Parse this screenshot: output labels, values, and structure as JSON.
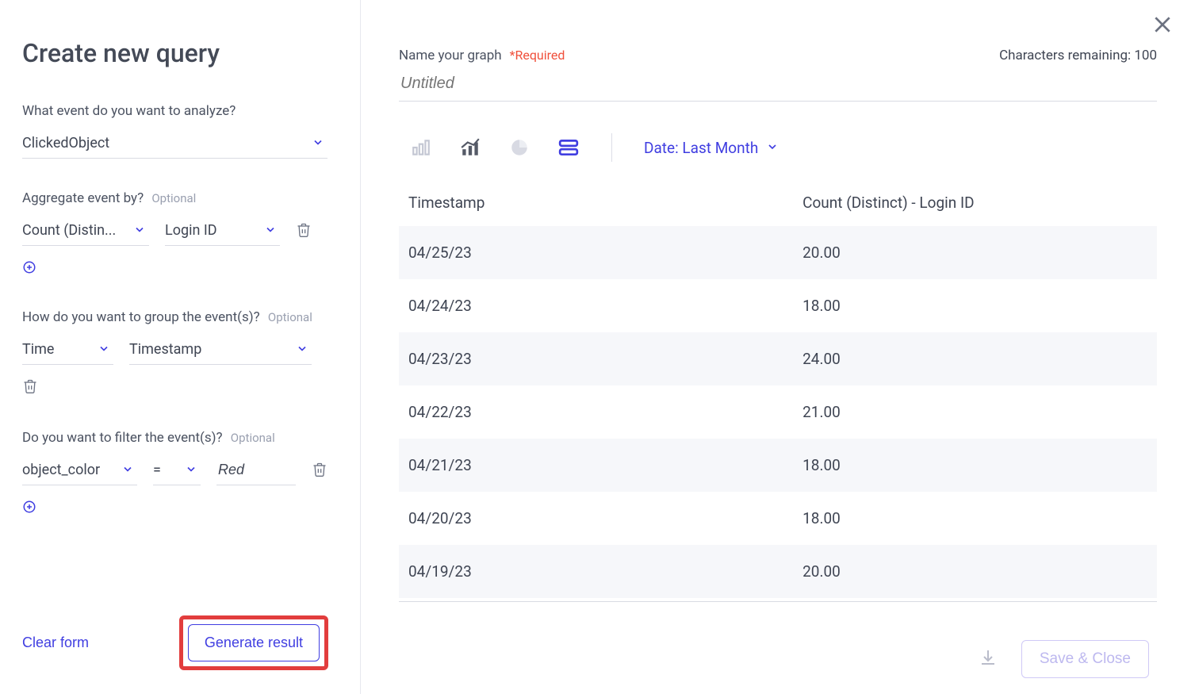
{
  "title": "Create new query",
  "sidebar": {
    "event_label": "What event do you want to analyze?",
    "event_value": "ClickedObject",
    "aggregate_label": "Aggregate event by?",
    "optional": "Optional",
    "aggregate_func": "Count (Distin...",
    "aggregate_field": "Login ID",
    "group_label": "How do you want to group the event(s)?",
    "group_by_1": "Time",
    "group_by_2": "Timestamp",
    "filter_label": "Do you want to filter the event(s)?",
    "filter_field": "object_color",
    "filter_op": "=",
    "filter_value": "Red",
    "clear": "Clear form",
    "generate": "Generate result"
  },
  "main": {
    "name_label": "Name your graph",
    "required": "*Required",
    "chars_label": "Characters remaining: 100",
    "name_placeholder": "Untitled",
    "date_range": "Date: Last Month",
    "columns": [
      "Timestamp",
      "Count (Distinct) - Login ID"
    ],
    "rows": [
      {
        "ts": "04/25/23",
        "val": "20.00"
      },
      {
        "ts": "04/24/23",
        "val": "18.00"
      },
      {
        "ts": "04/23/23",
        "val": "24.00"
      },
      {
        "ts": "04/22/23",
        "val": "21.00"
      },
      {
        "ts": "04/21/23",
        "val": "18.00"
      },
      {
        "ts": "04/20/23",
        "val": "18.00"
      },
      {
        "ts": "04/19/23",
        "val": "20.00"
      }
    ],
    "save": "Save & Close"
  },
  "chart_data": {
    "type": "table",
    "title": "",
    "columns": [
      "Timestamp",
      "Count (Distinct) - Login ID"
    ],
    "rows": [
      [
        "04/25/23",
        20.0
      ],
      [
        "04/24/23",
        18.0
      ],
      [
        "04/23/23",
        24.0
      ],
      [
        "04/22/23",
        21.0
      ],
      [
        "04/21/23",
        18.0
      ],
      [
        "04/20/23",
        18.0
      ],
      [
        "04/19/23",
        20.0
      ]
    ]
  }
}
